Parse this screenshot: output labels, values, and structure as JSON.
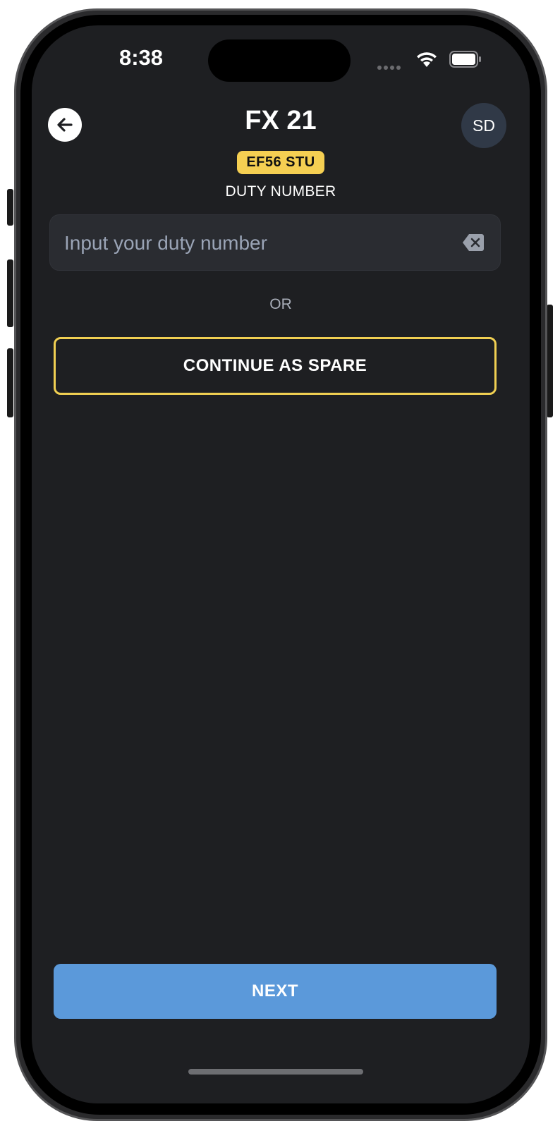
{
  "status_bar": {
    "time": "8:38"
  },
  "header": {
    "title": "FX 21",
    "registration": "EF56 STU",
    "avatar_initials": "SD"
  },
  "duty": {
    "label": "DUTY NUMBER",
    "input_value": "",
    "placeholder": "Input your duty number"
  },
  "or_text": "OR",
  "spare_button_label": "CONTINUE AS SPARE",
  "next_button_label": "NEXT",
  "colors": {
    "background": "#1e1f22",
    "accent_yellow": "#f5cf52",
    "primary_blue": "#5b99da",
    "avatar_bg": "#303947"
  },
  "icons": [
    "back-arrow-icon",
    "wifi-icon",
    "battery-icon",
    "clear-input-icon"
  ]
}
